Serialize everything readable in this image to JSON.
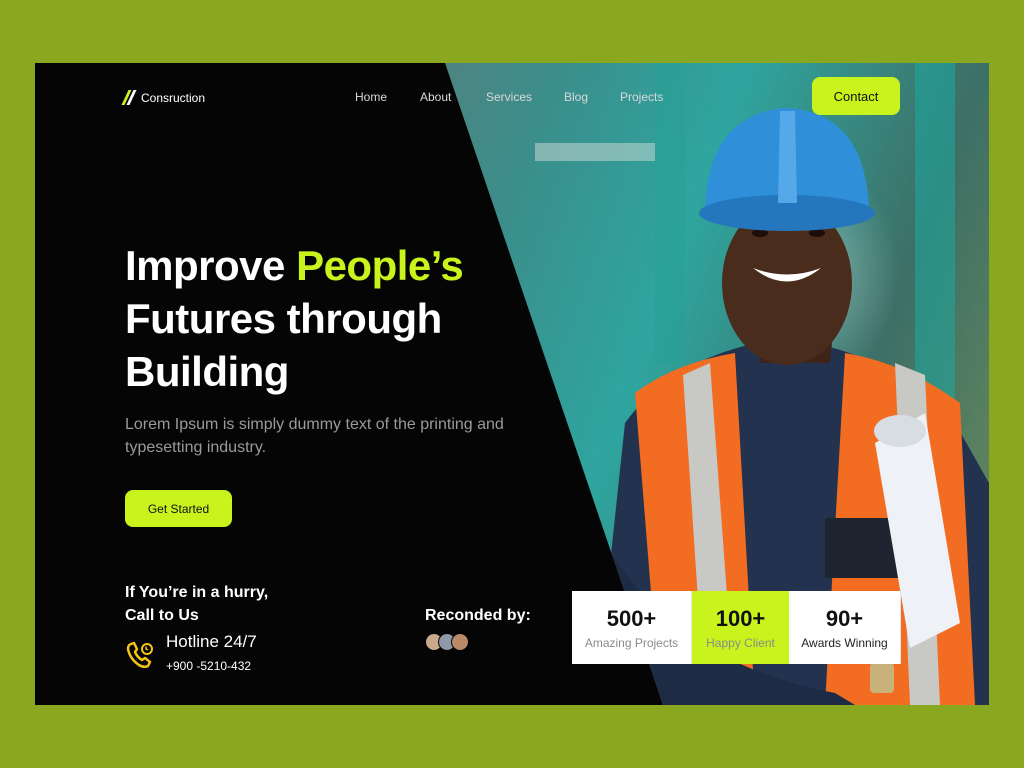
{
  "brand": {
    "name": "Consruction",
    "accent_color": "#c8f31d",
    "logo_icon": "slashes-logo-icon"
  },
  "nav": {
    "items": [
      "Home",
      "About",
      "Services",
      "Blog",
      "Projects"
    ],
    "contact_label": "Contact"
  },
  "hero": {
    "title_part1": "Improve ",
    "title_accent": "People’s",
    "title_part2": "Futures through",
    "title_part3": "Building",
    "description": "Lorem Ipsum is simply dummy text of the printing and typesetting industry.",
    "cta_label": "Get Started"
  },
  "contact_block": {
    "heading_line1": "If You’re  in a hurry,",
    "heading_line2": "Call to Us",
    "phone_icon": "phone-icon",
    "hotline_title": "Hotline 24/7",
    "hotline_number": "+900 -5210-432"
  },
  "recommended": {
    "label": "Reconded by:",
    "avatar_count": 3
  },
  "stats": [
    {
      "value": "500+",
      "label": "Amazing Projects"
    },
    {
      "value": "100+",
      "label": "Happy Client"
    },
    {
      "value": "90+",
      "label": "Awards Winning"
    }
  ]
}
